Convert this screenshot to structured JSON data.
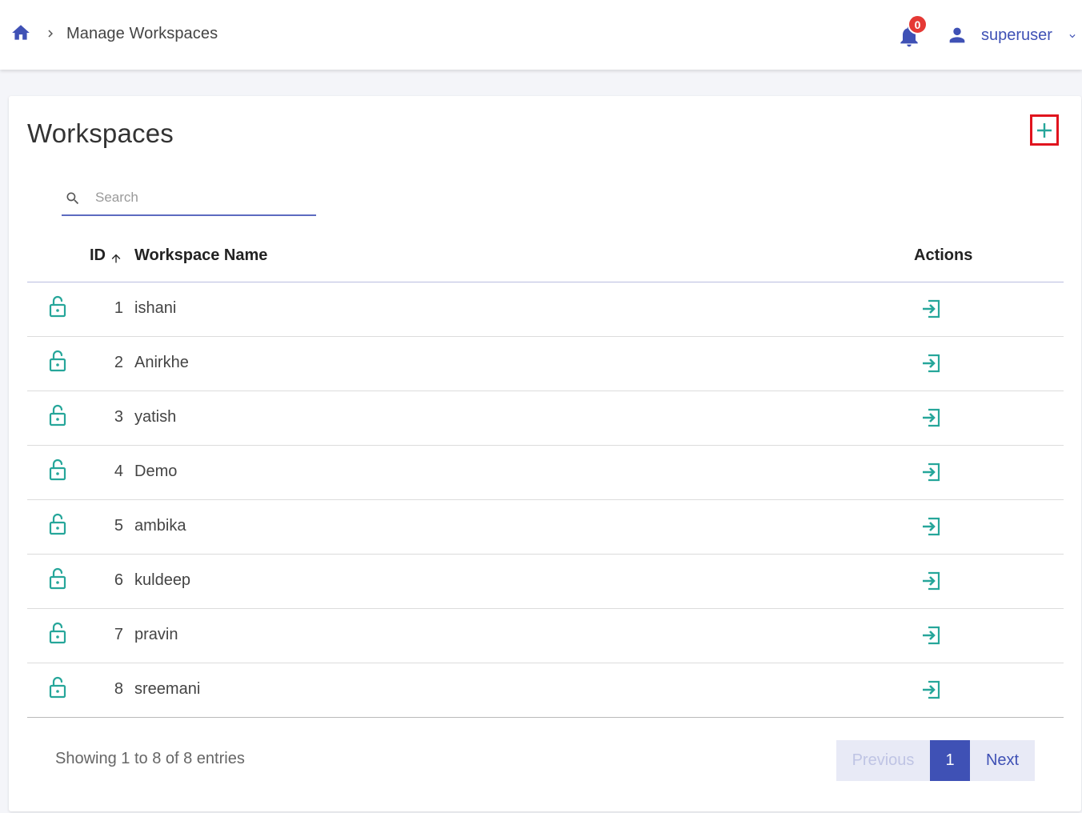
{
  "header": {
    "breadcrumb": "Manage Workspaces",
    "notification_count": "0",
    "username": "superuser"
  },
  "page": {
    "title": "Workspaces",
    "search_placeholder": "Search"
  },
  "table": {
    "columns": {
      "id": "ID",
      "name": "Workspace Name",
      "actions": "Actions"
    },
    "rows": [
      {
        "id": "1",
        "name": "ishani"
      },
      {
        "id": "2",
        "name": "Anirkhe"
      },
      {
        "id": "3",
        "name": "yatish"
      },
      {
        "id": "4",
        "name": "Demo"
      },
      {
        "id": "5",
        "name": "ambika"
      },
      {
        "id": "6",
        "name": "kuldeep"
      },
      {
        "id": "7",
        "name": "pravin"
      },
      {
        "id": "8",
        "name": "sreemani"
      }
    ]
  },
  "footer": {
    "entries_text": "Showing 1 to 8 of 8 entries",
    "previous": "Previous",
    "current_page": "1",
    "next": "Next"
  },
  "icons": {
    "home": "home-icon",
    "breadcrumb_separator": "chevron-right-icon",
    "notifications": "bell-icon",
    "user": "person-icon",
    "user_menu": "chevron-down-icon",
    "add": "plus-icon",
    "search": "search-icon",
    "sort": "arrow-up-icon",
    "row_lock": "lock-open-icon",
    "row_action": "login-icon"
  },
  "colors": {
    "primary": "#3f51b5",
    "accent": "#26a69a",
    "badge": "#e53935",
    "highlight_border": "#e0141e"
  }
}
